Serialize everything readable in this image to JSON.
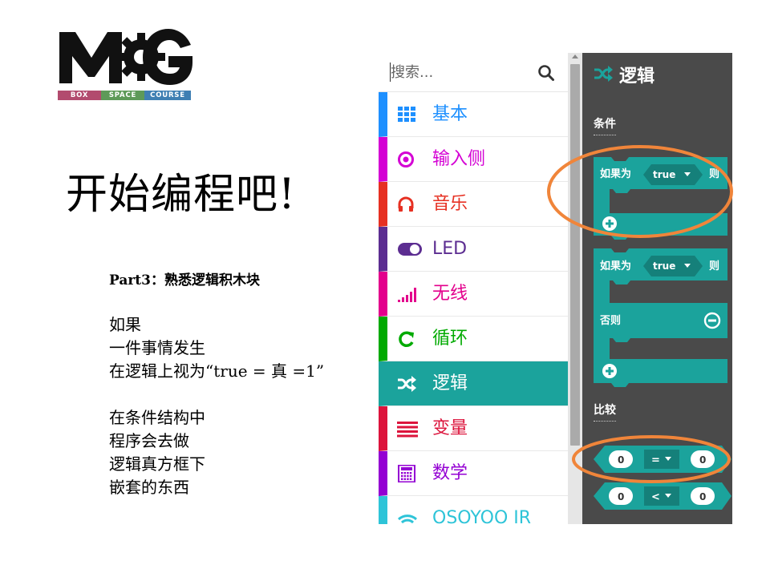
{
  "logo": {
    "letters": "MG",
    "bar": [
      {
        "label": "BOX",
        "color": "#b24b6e"
      },
      {
        "label": "SPACE",
        "color": "#5e9a58"
      },
      {
        "label": "COURSE",
        "color": "#3f7fb3"
      }
    ]
  },
  "slide": {
    "title": "开始编程吧!",
    "part_heading": "Part3：熟悉逻辑积木块",
    "paragraph1": [
      "如果",
      "一件事情发生",
      "在逻辑上视为“true = 真 =1”"
    ],
    "paragraph2": [
      "在条件结构中",
      "程序会去做",
      "逻辑真方框下",
      "嵌套的东西"
    ]
  },
  "makecode": {
    "search": {
      "placeholder": "搜索..."
    },
    "categories": [
      {
        "label": "基本",
        "icon": "grid-icon",
        "color": "#1e90ff",
        "selected": false
      },
      {
        "label": "输入侧",
        "icon": "target-icon",
        "color": "#d400d4",
        "selected": false
      },
      {
        "label": "音乐",
        "icon": "headphones-icon",
        "color": "#e63022",
        "selected": false
      },
      {
        "label": "LED",
        "icon": "toggle-icon",
        "color": "#5c2d91",
        "selected": false
      },
      {
        "label": "无线",
        "icon": "signal-bars-icon",
        "color": "#e3008c",
        "selected": false
      },
      {
        "label": "循环",
        "icon": "refresh-icon",
        "color": "#00aa00",
        "selected": false
      },
      {
        "label": "逻辑",
        "icon": "shuffle-icon",
        "color": "#1ba39c",
        "selected": true
      },
      {
        "label": "变量",
        "icon": "list-lines-icon",
        "color": "#dc143c",
        "selected": false
      },
      {
        "label": "数学",
        "icon": "calculator-icon",
        "color": "#9400d3",
        "selected": false
      },
      {
        "label": "OSOYOO IR",
        "icon": "wifi-icon",
        "color": "#2ec4d8",
        "selected": false
      }
    ],
    "flyout": {
      "title": "逻辑",
      "section_conditions": "条件",
      "section_compare": "比较",
      "block_if_then": {
        "if_label": "如果为",
        "value": "true",
        "then_label": "则"
      },
      "block_if_else": {
        "if_label": "如果为",
        "value": "true",
        "then_label": "则",
        "else_label": "否则"
      },
      "compare_eq": {
        "left": "0",
        "op": "=",
        "right": "0"
      },
      "compare_lt": {
        "left": "0",
        "op": "<",
        "right": "0"
      }
    },
    "colors": {
      "logic": "#1ba39c",
      "flyout_bg": "#4a4a4a",
      "highlight": "#f0853a"
    }
  }
}
